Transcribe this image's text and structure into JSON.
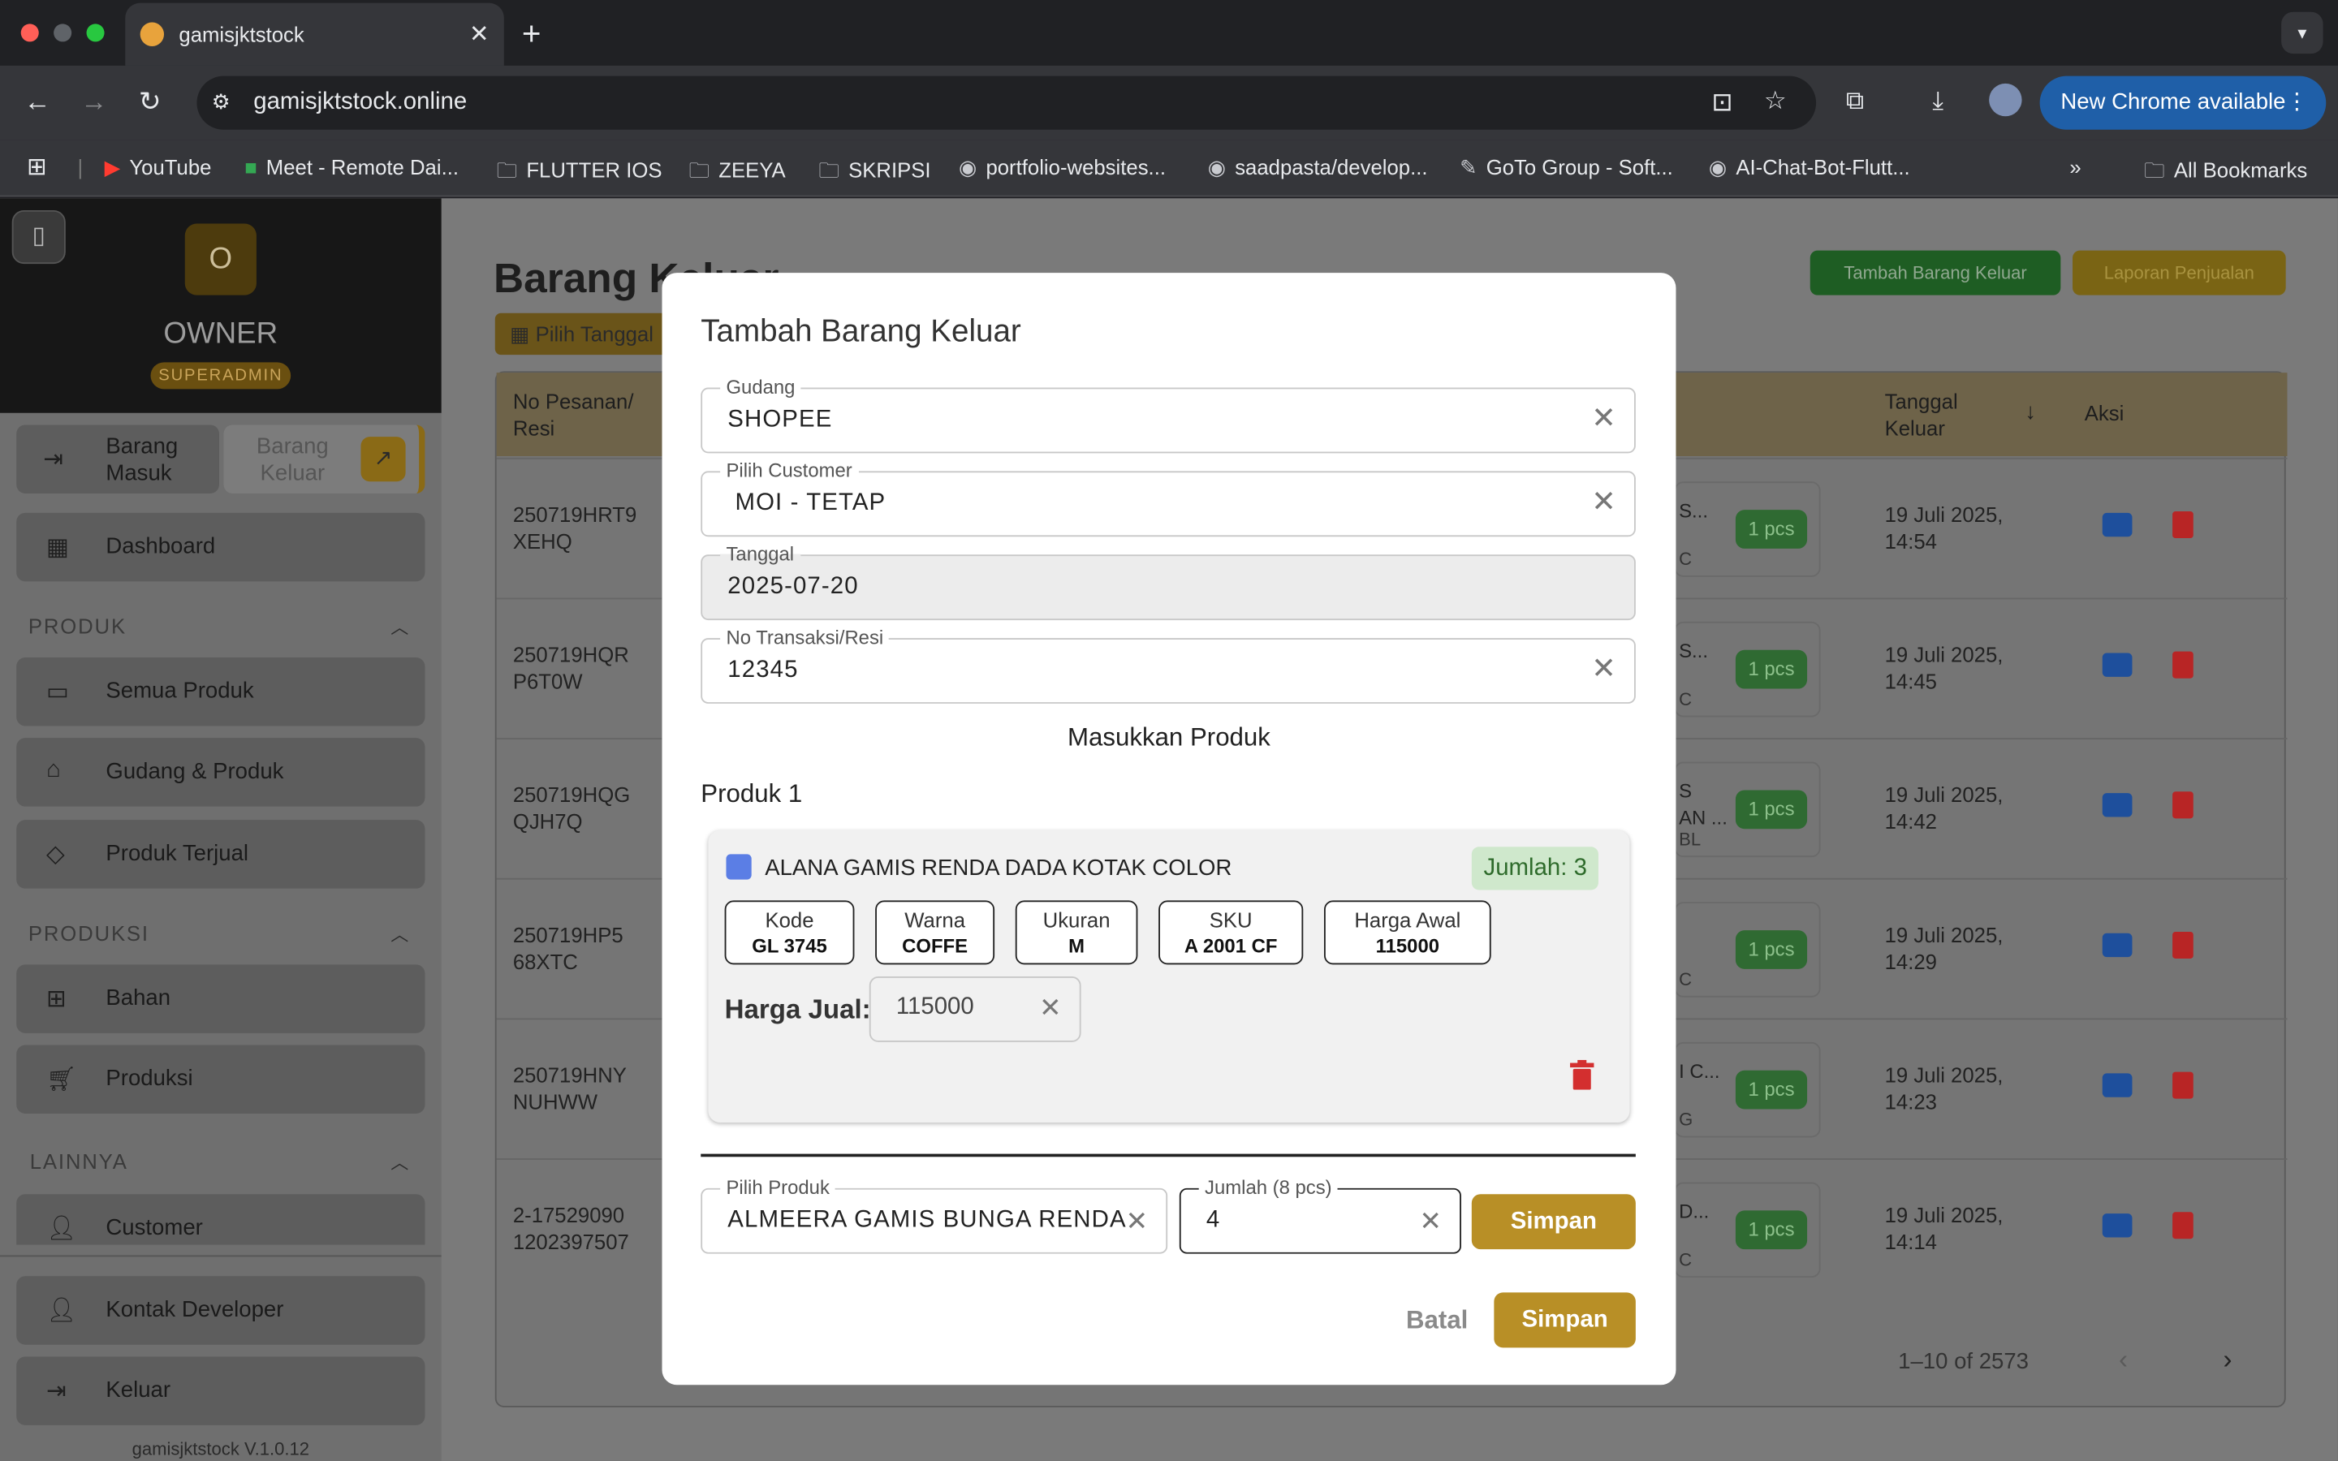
{
  "browser": {
    "tab_title": "gamisjktstock",
    "url": "gamisjktstock.online",
    "update_label": "New Chrome available",
    "bookmarks": [
      "YouTube",
      "Meet - Remote Dai...",
      "FLUTTER IOS",
      "ZEEYA",
      "SKRIPSI",
      "portfolio-websites...",
      "saadpasta/develop...",
      "GoTo Group - Soft...",
      "AI-Chat-Bot-Flutt..."
    ],
    "all_bookmarks": "All Bookmarks"
  },
  "sidebar": {
    "logo_letter": "O",
    "user": "OWNER",
    "role": "SUPERADMIN",
    "barang_masuk": "Barang\nMasuk",
    "barang_keluar": "Barang\nKeluar",
    "dashboard": "Dashboard",
    "sec_produk": "PRODUK",
    "semua_produk": "Semua Produk",
    "gudang_produk": "Gudang & Produk",
    "produk_terjual": "Produk Terjual",
    "sec_produksi": "PRODUKSI",
    "bahan": "Bahan",
    "produksi": "Produksi",
    "sec_lainnya": "LAINNYA",
    "customer": "Customer",
    "kontak": "Kontak Developer",
    "keluar": "Keluar",
    "version": "gamisjktstock V.1.0.12"
  },
  "page": {
    "title": "Barang Keluar",
    "date_filter": "Pilih Tanggal",
    "add_button": "Tambah Barang Keluar",
    "report_button": "Laporan Penjualan",
    "col_order": "No Pesanan/\nResi",
    "col_date": "Tanggal\nKeluar",
    "col_action": "Aksi",
    "pagination": "1–10 of 2573",
    "rows": [
      {
        "order": "250719HRT9\nXEHQ",
        "product": "S...",
        "sub": "C",
        "qty": "1 pcs",
        "date": "19 Juli 2025,\n14:54"
      },
      {
        "order": "250719HQR\nP6T0W",
        "product": "S...",
        "sub": "C",
        "qty": "1 pcs",
        "date": "19 Juli 2025,\n14:45"
      },
      {
        "order": "250719HQG\nQJH7Q",
        "product": "S\nAN ...",
        "sub": "BL",
        "qty": "1 pcs",
        "date": "19 Juli 2025,\n14:42"
      },
      {
        "order": "250719HP5\n68XTC",
        "product": "",
        "sub": "C",
        "qty": "1 pcs",
        "date": "19 Juli 2025,\n14:29"
      },
      {
        "order": "250719HNY\nNUHWW",
        "product": "I C...",
        "sub": "G",
        "qty": "1 pcs",
        "date": "19 Juli 2025,\n14:23"
      },
      {
        "order": "2-17529090\n1202397507",
        "product": "D...",
        "sub": "C",
        "qty": "1 pcs",
        "date": "19 Juli 2025,\n14:14"
      }
    ]
  },
  "modal": {
    "title": "Tambah Barang Keluar",
    "gudang_label": "Gudang",
    "gudang_value": "SHOPEE",
    "customer_label": "Pilih Customer",
    "customer_value": "MOI - TETAP",
    "tanggal_label": "Tanggal",
    "tanggal_value": "2025-07-20",
    "resi_label": "No Transaksi/Resi",
    "resi_value": "12345",
    "section_title": "Masukkan Produk",
    "product_heading": "Produk 1",
    "product_name": "ALANA GAMIS RENDA DADA KOTAK COLOR",
    "jumlah_badge": "Jumlah: 3",
    "chips": [
      {
        "k": "Kode",
        "v": "GL 3745"
      },
      {
        "k": "Warna",
        "v": "COFFE"
      },
      {
        "k": "Ukuran",
        "v": "M"
      },
      {
        "k": "SKU",
        "v": "A 2001 CF"
      },
      {
        "k": "Harga Awal",
        "v": "115000"
      }
    ],
    "harga_jual_label": "Harga Jual:",
    "harga_jual_value": "115000",
    "pilih_produk_label": "Pilih Produk",
    "pilih_produk_value": "ALMEERA GAMIS BUNGA RENDA",
    "jumlah_label": "Jumlah (8 pcs)",
    "jumlah_value": "4",
    "simpan_inline": "Simpan",
    "batal": "Batal",
    "simpan": "Simpan"
  },
  "colors": {
    "gold": "#b88f26",
    "green_badge": "#2e7d32",
    "trash": "#d32f2f",
    "print": "#1e4f9c"
  }
}
